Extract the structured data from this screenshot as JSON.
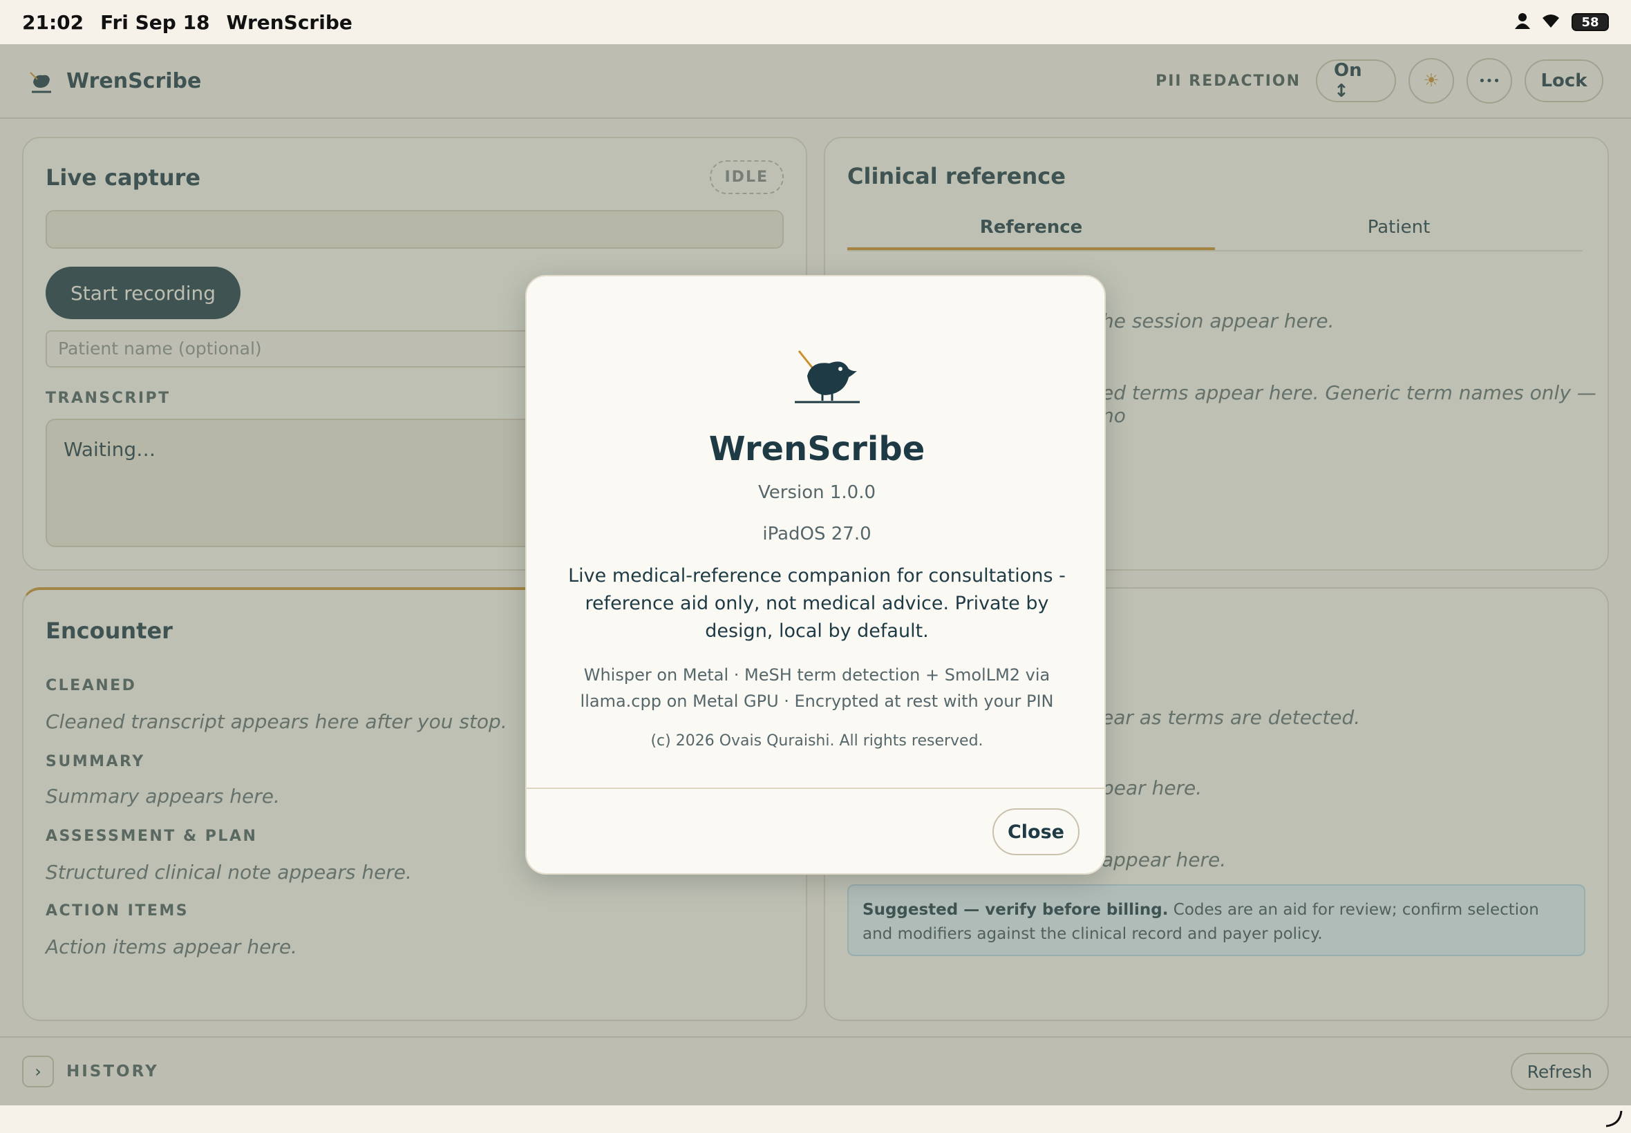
{
  "status_bar": {
    "time": "21:02",
    "date": "Fri Sep 18",
    "app": "WrenScribe",
    "battery": "58"
  },
  "app_bar": {
    "brand": "WrenScribe",
    "pii_label": "PII REDACTION",
    "pii_value": "On ↕",
    "theme_icon": "☀",
    "more_icon": "•••",
    "lock_label": "Lock"
  },
  "live_capture": {
    "title": "Live capture",
    "status_badge": "IDLE",
    "record_label": "Start recording",
    "patient_placeholder": "Patient name (optional)",
    "transcript_label": "TRANSCRIPT",
    "transcript_value": "Waiting…"
  },
  "clinical_reference": {
    "title": "Clinical reference",
    "tabs": [
      "Reference",
      "Patient"
    ],
    "text_1": "he session appear here.",
    "text_2": "ed terms appear here. Generic term names only — no"
  },
  "encounter": {
    "title": "Encounter",
    "sections": [
      {
        "label": "CLEANED",
        "text": "Cleaned transcript appears here after you stop."
      },
      {
        "label": "SUMMARY",
        "text": "Summary appears here."
      },
      {
        "label": "ASSESSMENT & PLAN",
        "text": "Structured clinical note appears here."
      },
      {
        "label": "ACTION ITEMS",
        "text": "Action items appear here."
      }
    ]
  },
  "codes_panel": {
    "text_1": "ear as terms are detected.",
    "text_2": "pear here.",
    "text_3": "appear here.",
    "billing_bold": "Suggested — verify before billing.",
    "billing_rest": " Codes are an aid for review; confirm selection and modifiers against the clinical record and payer policy."
  },
  "history": {
    "label": "HISTORY",
    "refresh_label": "Refresh",
    "chevron": "›"
  },
  "about_modal": {
    "title": "WrenScribe",
    "version": "Version 1.0.0",
    "os": "iPadOS 27.0",
    "description": "Live medical-reference companion for consultations - reference aid only, not medical advice. Private by design, local by default.",
    "tech": "Whisper on Metal · MeSH term detection + SmolLM2 via llama.cpp on Metal GPU · Encrypted at rest with your PIN",
    "copyright": "(c) 2026 Ovais Quraishi. All rights reserved.",
    "close_label": "Close"
  },
  "icons": {
    "brand": "wren-bird-icon",
    "theme": "sun-icon",
    "more": "ellipsis-icon",
    "history_toggle": "chevron-right-icon"
  },
  "colors": {
    "primary": "#1d3a45",
    "accent": "#c8902e",
    "background": "#f6f2e9"
  }
}
